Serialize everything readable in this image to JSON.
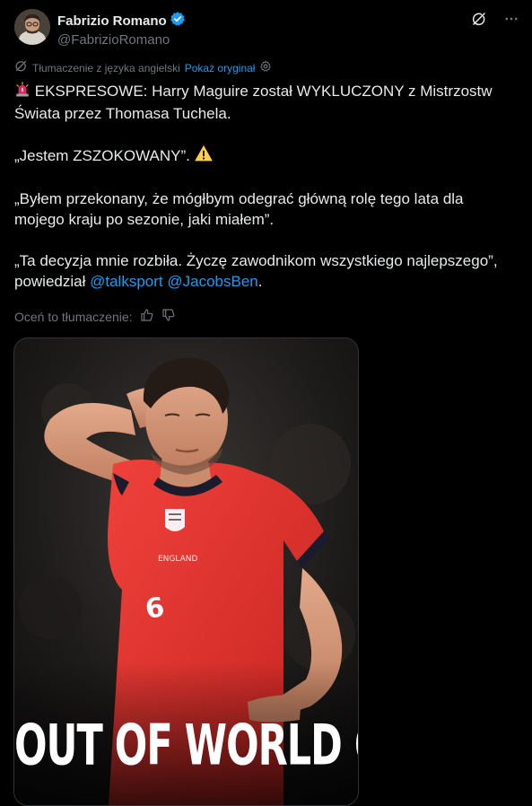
{
  "author": {
    "display_name": "Fabrizio Romano",
    "handle": "@FabrizioRomano",
    "verified": true
  },
  "translation": {
    "notice": "Tłumaczenie z języka angielski",
    "show_original": "Pokaż oryginał"
  },
  "tweet": {
    "line1_emoji": "🚨",
    "line1_text": "EKSPRESOWE: Harry Maguire został WYKLUCZONY z Mistrzostw Świata przez Thomasa Tuchela.",
    "line2_text": "„Jestem ZSZOKOWANY”.",
    "line2_emoji": "⚠️",
    "line3_text": "„Byłem przekonany, że mógłbym odegrać główną rolę tego lata dla mojego kraju po sezonie, jaki miałem”.",
    "line4_text": "„Ta decyzja mnie rozbiła. Życzę zawodnikom wszystkiego najlepszego”, powiedział ",
    "mention1": "@talksport",
    "mention2": "@JacobsBen",
    "line4_end": "."
  },
  "rating": {
    "label": "Oceń to tłumaczenie:"
  },
  "media": {
    "caption": "OUT OF WORLD CUP",
    "shirt_number": "6"
  },
  "colors": {
    "background": "#000000",
    "text": "#e7e9ea",
    "muted": "#71767b",
    "link": "#1d9bf0",
    "shirt": "#e8302c"
  },
  "icons": [
    "verified-badge-icon",
    "grok-icon",
    "more-icon",
    "translate-icon",
    "settings-icon",
    "thumbs-up-icon",
    "thumbs-down-icon",
    "siren-emoji",
    "warning-emoji"
  ]
}
